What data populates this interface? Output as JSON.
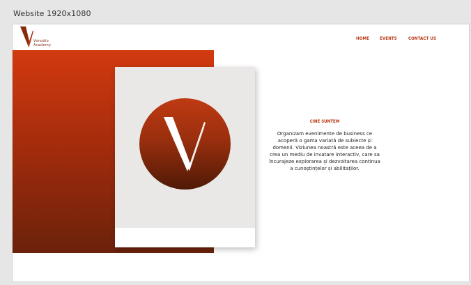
{
  "canvas": {
    "label": "Website 1920x1080"
  },
  "logo": {
    "line1": "Vonodio",
    "line2": "Academy"
  },
  "nav": {
    "items": [
      {
        "label": "HOME"
      },
      {
        "label": "EVENTS"
      },
      {
        "label": "CONTACT US"
      }
    ]
  },
  "about": {
    "title": "CINE SUNTEM",
    "text": "Organizam evenimente de business ce acoperă o gama variată de subiecte și domenii. Viziunea noastră este aceea de a crea un mediu de invatare interactiv, care sa încurajeze explorarea și dezvoltarea continua a cunoștințelor și abilitaților."
  },
  "colors": {
    "accent": "#b8330f",
    "red_top": "#d23a10",
    "red_bottom": "#6b220b",
    "card_bg": "#e9e8e6"
  }
}
